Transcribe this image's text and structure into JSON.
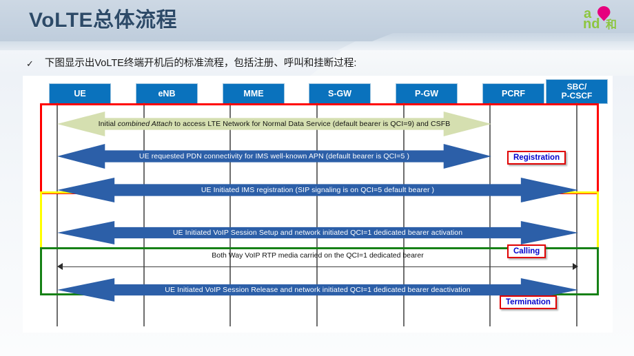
{
  "header": {
    "title": "VoLTE总体流程",
    "logo_name": "china-mobile-he-logo",
    "logo_colors": {
      "green": "#8dc63f",
      "magenta": "#e6007e"
    }
  },
  "bullet": {
    "marker": "✓",
    "text": "下图显示出VoLTE终端开机后的标准流程，包括注册、呼叫和挂断过程:"
  },
  "diagram": {
    "type": "sequence-diagram",
    "nodes": [
      {
        "id": "ue",
        "label": "UE"
      },
      {
        "id": "enb",
        "label": "eNB"
      },
      {
        "id": "mme",
        "label": "MME"
      },
      {
        "id": "sgw",
        "label": "S-GW"
      },
      {
        "id": "pgw",
        "label": "P-GW"
      },
      {
        "id": "pcrf",
        "label": "PCRF"
      },
      {
        "id": "sbc",
        "label": "SBC/\nP-CSCF",
        "line1": "SBC/",
        "line2": "P-CSCF"
      }
    ],
    "messages": [
      {
        "id": "attach",
        "style": "block-arrow-green",
        "direction": "bidirectional",
        "from": "ue",
        "to": "pcrf",
        "text_parts": [
          {
            "text": "Initial ",
            "italic": false
          },
          {
            "text": "combined Attach",
            "italic": true
          },
          {
            "text": " to access LTE Network for Normal Data Service  (default bearer is QCI=9)  and CSFB",
            "italic": false
          }
        ],
        "text": "Initial combined Attach to access LTE Network for Normal Data Service  (default bearer is QCI=9)  and CSFB"
      },
      {
        "id": "pdn",
        "style": "block-arrow-blue",
        "direction": "bidirectional",
        "from": "ue",
        "to": "pcrf",
        "text": "UE requested PDN connectivity for IMS well-known APN (default bearer is QCI=5 )"
      },
      {
        "id": "ims-reg",
        "style": "block-arrow-blue",
        "direction": "bidirectional",
        "from": "ue",
        "to": "sbc",
        "text": "UE Initiated IMS registration (SIP signaling is on QCI=5 default bearer )"
      },
      {
        "id": "voip-setup",
        "style": "block-arrow-blue",
        "direction": "bidirectional",
        "from": "ue",
        "to": "sbc",
        "text": "UE Initiated VoIP Session Setup and network initiated QCI=1 dedicated bearer activation"
      },
      {
        "id": "rtp-media",
        "style": "thin-line",
        "direction": "bidirectional",
        "from": "ue",
        "to": "sbc",
        "text": "Both Way VoIP RTP media carried on the QCI=1 dedicated bearer"
      },
      {
        "id": "voip-release",
        "style": "block-arrow-blue",
        "direction": "bidirectional",
        "from": "ue",
        "to": "sbc",
        "text": "UE Initiated VoIP Session Release and network initiated QCI=1 dedicated bearer deactivation"
      }
    ],
    "phases": [
      {
        "id": "registration",
        "label": "Registration",
        "frame_color": "#ff0000"
      },
      {
        "id": "calling",
        "label": "Calling",
        "frame_color": "#ffff00"
      },
      {
        "id": "termination",
        "label": "Termination",
        "frame_color": "#168116"
      }
    ],
    "colors": {
      "node_box": "#0a72bd",
      "block_arrow_blue": "#2c5fa8",
      "block_arrow_green": "#d5dfb0",
      "callout_text": "#0000cc",
      "callout_border": "#e00000"
    }
  }
}
